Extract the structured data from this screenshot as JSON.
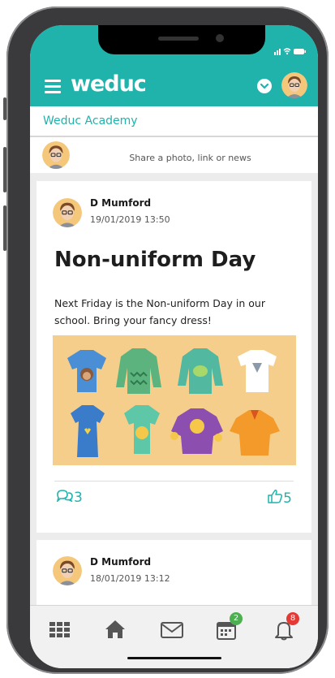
{
  "app": {
    "logo_text": "weduc",
    "accent_color": "#1fb3ab"
  },
  "header": {
    "menu_icon": "hamburger-menu-icon",
    "dropdown_icon": "chevron-down-icon",
    "avatar_icon": "user-avatar"
  },
  "school": {
    "name": "Weduc Academy"
  },
  "composer": {
    "placeholder": "Share a photo, link or news"
  },
  "posts": [
    {
      "author": "D Mumford",
      "date": "19/01/2019 13:50",
      "title": "Non-uniform Day",
      "body": "Next Friday is the Non-uniform Day in our school. Bring your fancy dress!",
      "image_icon": "clothing-illustration",
      "comments": "3",
      "likes": "5"
    },
    {
      "author": "D Mumford",
      "date": "18/01/2019 13:12"
    }
  ],
  "tabbar": {
    "items": [
      {
        "icon": "apps-grid-icon"
      },
      {
        "icon": "home-icon"
      },
      {
        "icon": "mail-icon"
      },
      {
        "icon": "calendar-icon",
        "badge": "2",
        "badge_color": "#4caf50"
      },
      {
        "icon": "bell-icon",
        "badge": "8",
        "badge_color": "#e53935"
      }
    ]
  }
}
